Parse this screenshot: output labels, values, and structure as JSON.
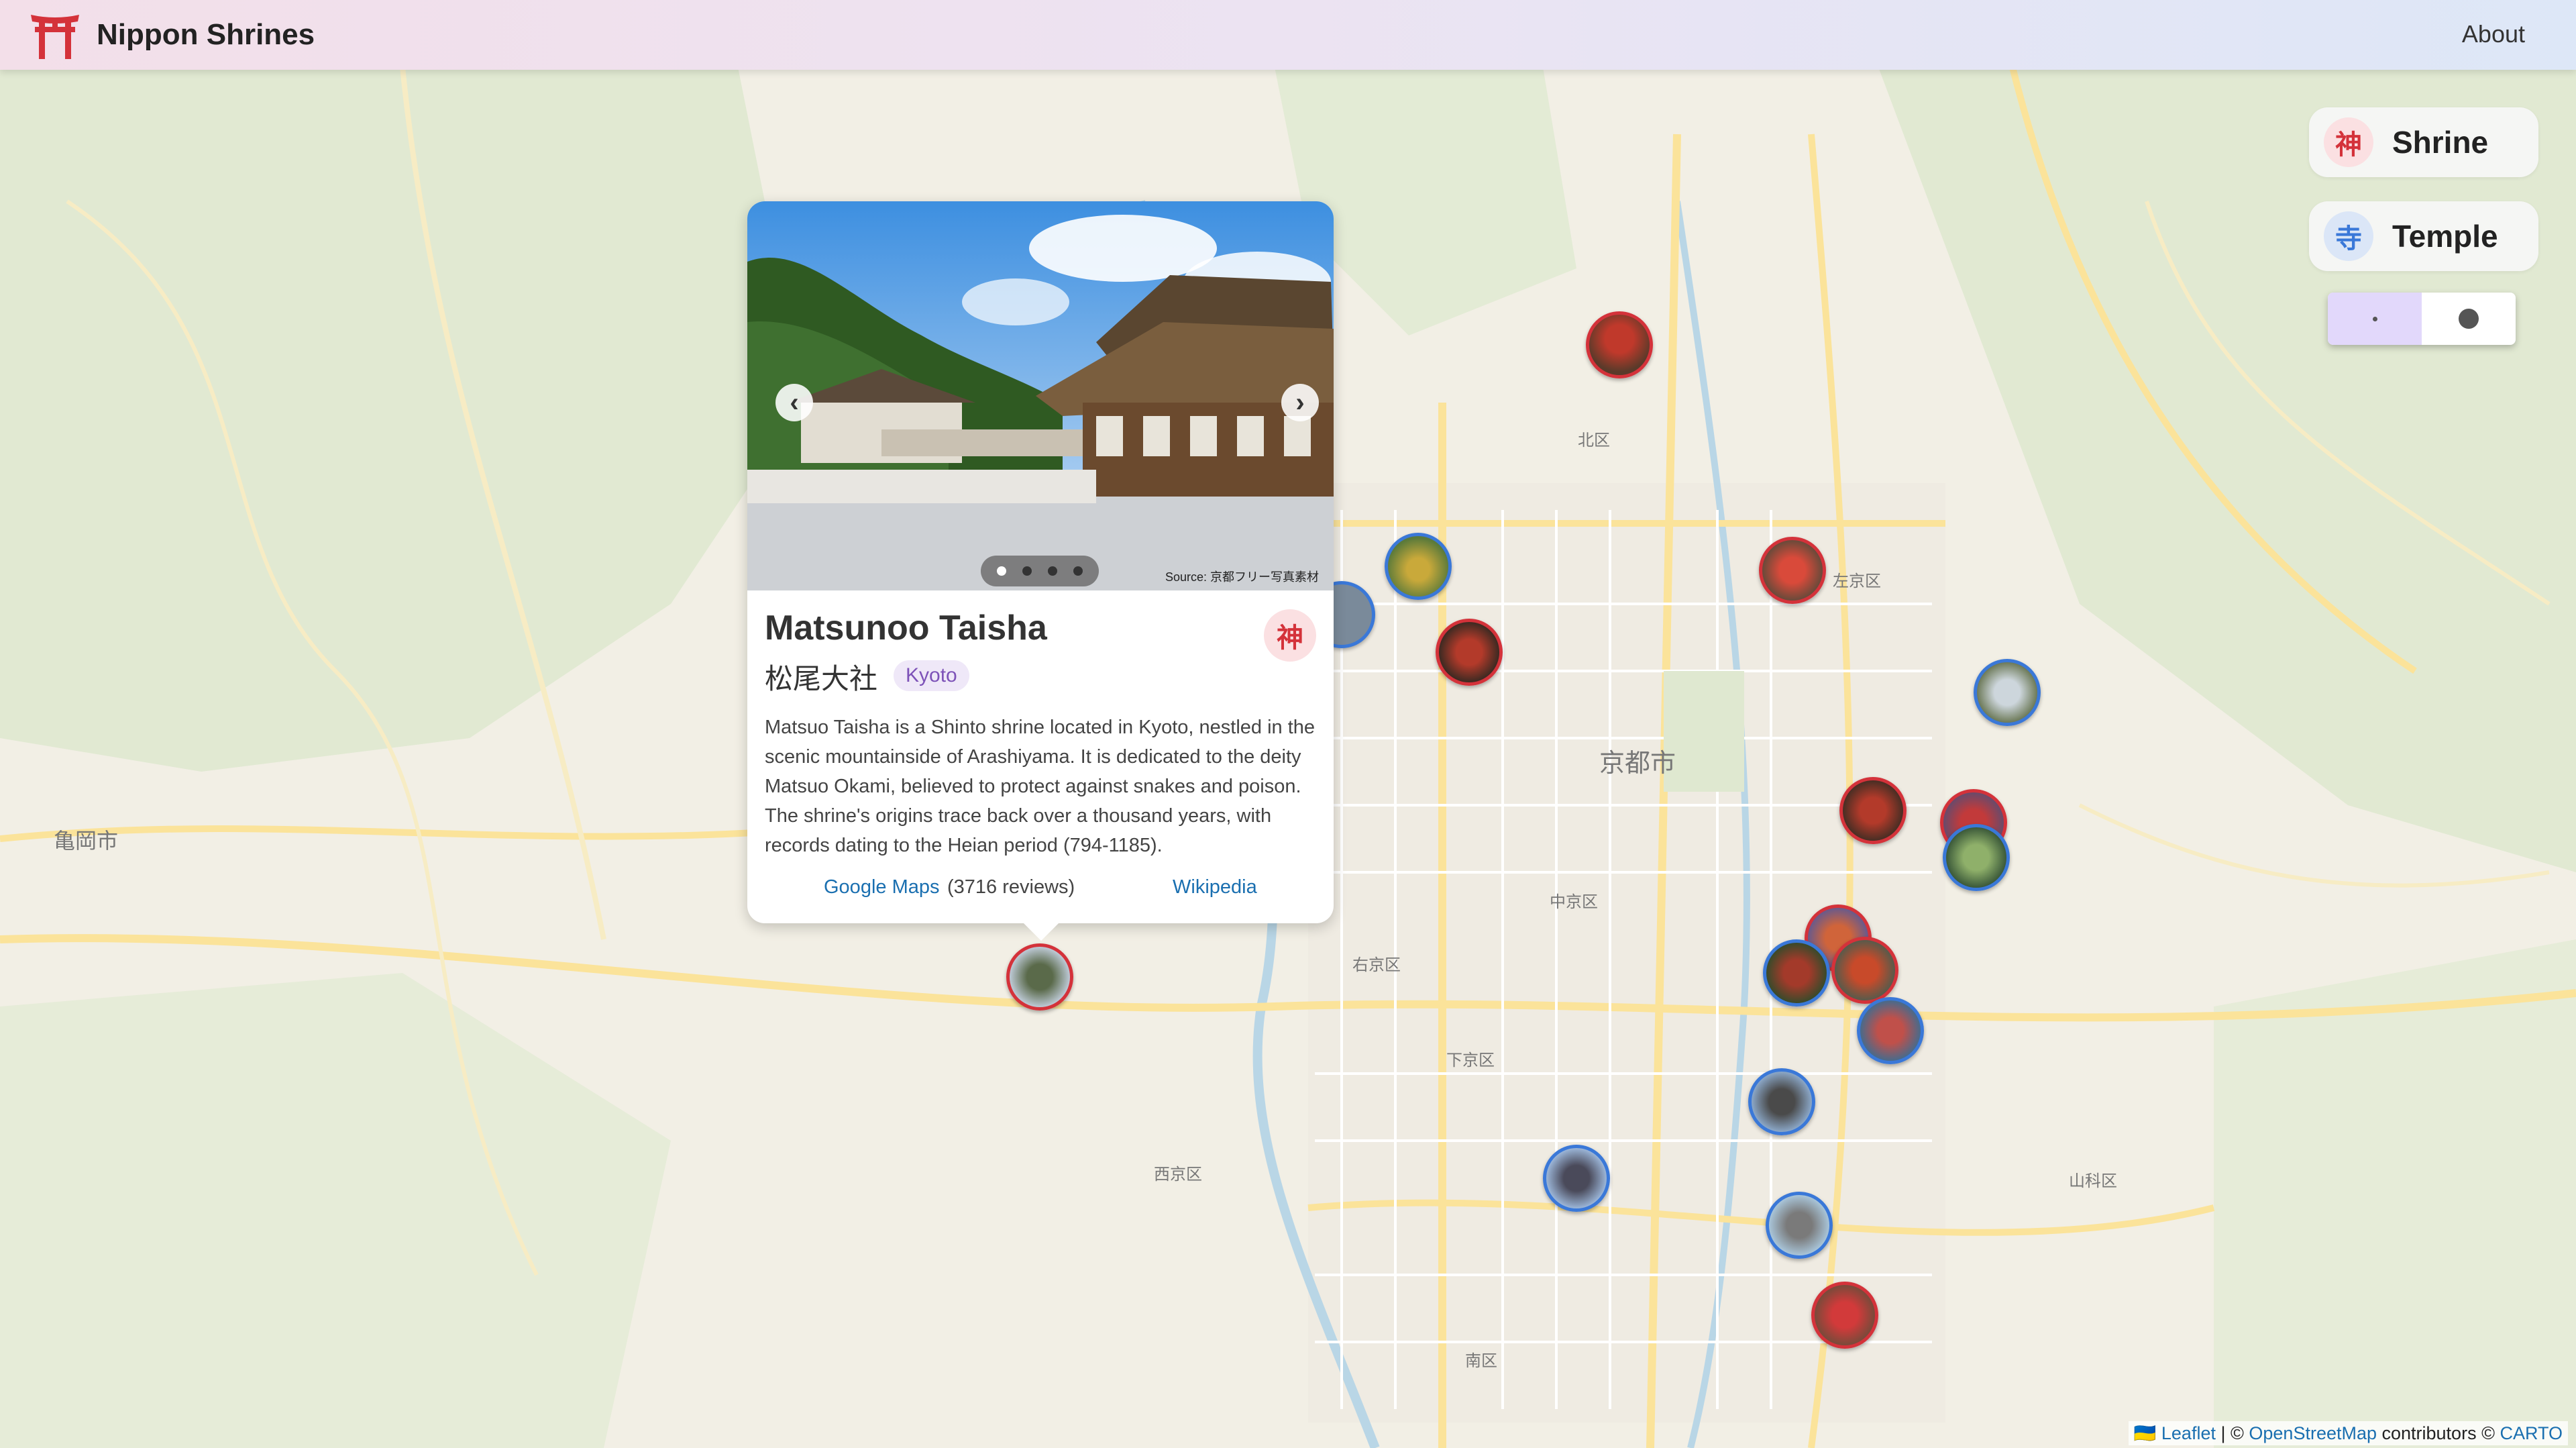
{
  "header": {
    "app_title": "Nippon Shrines",
    "about_label": "About"
  },
  "legend": {
    "shrine": {
      "glyph": "神",
      "label": "Shrine",
      "color": "#d4323a"
    },
    "temple": {
      "glyph": "寺",
      "label": "Temple",
      "color": "#3a78d8"
    }
  },
  "size_toggle": {
    "selected": "small"
  },
  "popup": {
    "photo_source": "Source: 京都フリー写真素材",
    "title": "Matsunoo Taisha",
    "name_jp": "松尾大社",
    "prefecture": "Kyoto",
    "type_glyph": "神",
    "description": "Matsuo Taisha is a Shinto shrine located in Kyoto, nestled in the scenic mountainside of Arashiyama. It is dedicated to the deity Matsuo Okami, believed to protect against snakes and poison. The shrine's origins trace back over a thousand years, with records dating to the Heian period (794-1185).",
    "google_maps_label": "Google Maps",
    "reviews": "(3716 reviews)",
    "wikipedia_label": "Wikipedia",
    "carousel": {
      "count": 4,
      "active": 1
    },
    "prev_glyph": "‹",
    "next_glyph": "›"
  },
  "map_labels": {
    "kyoto_city": "京都市",
    "kameoka": "亀岡市",
    "kita_ku": "北区",
    "sakyo_ku": "左京区",
    "nakagyo_ku": "中京区",
    "ukyo_ku": "右京区",
    "shimogyo_ku": "下京区",
    "nishikyo_ku": "西京区",
    "yamashina_ku": "山科区",
    "minami_ku": "南区"
  },
  "attribution": {
    "flag": "🇺🇦",
    "leaflet": "Leaflet",
    "sep": " | © ",
    "osm": "OpenStreetMap",
    "contributors": " contributors © ",
    "carto": "CARTO"
  }
}
